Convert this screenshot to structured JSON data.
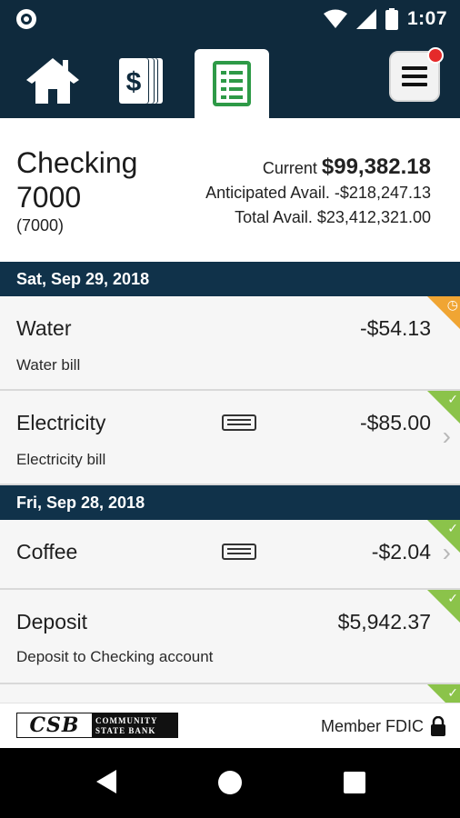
{
  "status_bar": {
    "time": "1:07",
    "icons": [
      "record-dot-icon",
      "wifi-icon",
      "signal-icon",
      "battery-icon"
    ]
  },
  "nav": {
    "items": [
      "home-icon",
      "money-transfer-icon",
      "account-register-icon",
      "menu-icon"
    ],
    "active": "account-register-icon",
    "menu_has_notification": true
  },
  "account": {
    "name": "Checking 7000",
    "number": "(7000)",
    "current_label": "Current",
    "current_value": "$99,382.18",
    "anticipated_label": "Anticipated Avail.",
    "anticipated_value": "-$218,247.13",
    "total_label": "Total Avail.",
    "total_value": "$23,412,321.00"
  },
  "groups": [
    {
      "date": "Sat, Sep 29, 2018",
      "transactions": [
        {
          "title": "Water",
          "subtitle": "Water bill",
          "amount": "-$54.13",
          "status": "pending"
        },
        {
          "title": "Electricity",
          "subtitle": "Electricity bill",
          "amount": "-$85.00",
          "status": "cleared"
        }
      ]
    },
    {
      "date": "Fri, Sep 28, 2018",
      "transactions": [
        {
          "title": "Coffee",
          "subtitle": "",
          "amount": "-$2.04",
          "status": "cleared"
        },
        {
          "title": "Deposit",
          "subtitle": "Deposit to Checking account",
          "amount": "$5,942.37",
          "status": "cleared"
        }
      ]
    }
  ],
  "footer": {
    "logo_main": "CSB",
    "logo_line1": "COMMUNITY",
    "logo_line2": "STATE BANK",
    "fdic_text": "Member FDIC"
  },
  "colors": {
    "header_navy": "#0f2a3d",
    "date_bar": "#10324a",
    "cleared_green": "#8bc34a",
    "pending_orange": "#f0a533",
    "active_icon_green": "#2e9a47",
    "notification_red": "#e52a2a"
  }
}
